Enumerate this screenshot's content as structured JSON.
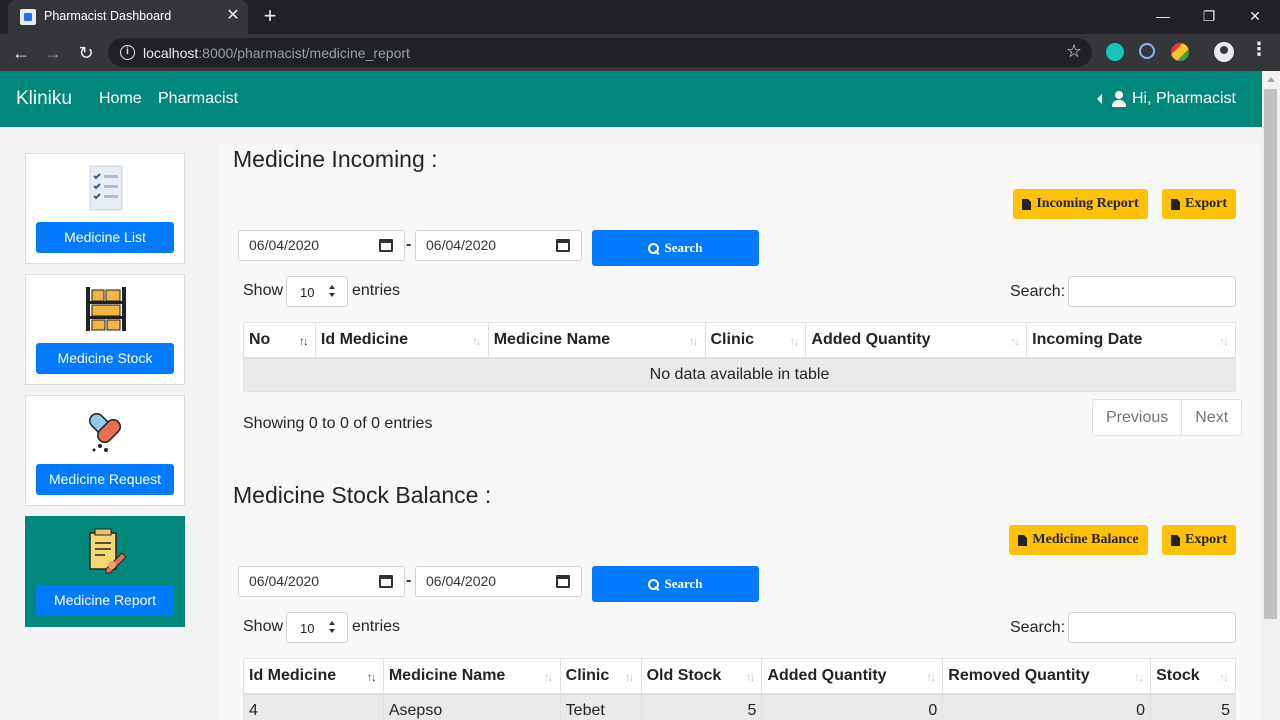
{
  "browser": {
    "tab_title": "Pharmacist Dashboard",
    "url_host": "localhost",
    "url_path": ":8000/pharmacist/medicine_report",
    "window": {
      "minimize": "—",
      "restore": "❐",
      "close": "✕"
    },
    "icons": [
      "back-icon",
      "forward-icon",
      "reload-icon",
      "info-icon",
      "star-icon",
      "profile-icon",
      "menu-icon"
    ]
  },
  "navbar": {
    "brand": "Kliniku",
    "links": [
      "Home",
      "Pharmacist"
    ],
    "greeting": "Hi, Pharmacist",
    "color": "#00897b"
  },
  "sidebar": {
    "items": [
      {
        "label": "Medicine List",
        "icon": "checklist-icon",
        "active": false
      },
      {
        "label": "Medicine Stock",
        "icon": "shelves-icon",
        "active": false
      },
      {
        "label": "Medicine Request",
        "icon": "pills-icon",
        "active": false
      },
      {
        "label": "Medicine Report",
        "icon": "report-icon",
        "active": true
      }
    ]
  },
  "incoming": {
    "title": "Medicine Incoming :",
    "report_button": "Incoming Report",
    "export_button": "Export",
    "date_from": "06/04/2020",
    "date_to": "06/04/2020",
    "date_separator": "-",
    "search_button": "Search",
    "show_label": "Show",
    "entries_value": "10",
    "entries_label": "entries",
    "search_label": "Search:",
    "columns": [
      "No",
      "Id Medicine",
      "Medicine Name",
      "Clinic",
      "Added Quantity",
      "Incoming Date"
    ],
    "empty_message": "No data available in table",
    "info": "Showing 0 to 0 of 0 entries",
    "prev": "Previous",
    "next": "Next"
  },
  "balance": {
    "title": "Medicine Stock Balance :",
    "report_button": "Medicine Balance",
    "export_button": "Export",
    "date_from": "06/04/2020",
    "date_to": "06/04/2020",
    "date_separator": "-",
    "search_button": "Search",
    "show_label": "Show",
    "entries_value": "10",
    "entries_label": "entries",
    "search_label": "Search:",
    "columns": [
      "Id Medicine",
      "Medicine Name",
      "Clinic",
      "Old Stock",
      "Added Quantity",
      "Removed Quantity",
      "Stock"
    ],
    "rows": [
      [
        "4",
        "Asepso",
        "Tebet",
        "5",
        "0",
        "0",
        "5"
      ]
    ]
  },
  "colors": {
    "primary": "#007bff",
    "warning": "#ffc107",
    "teal": "#00897b"
  }
}
